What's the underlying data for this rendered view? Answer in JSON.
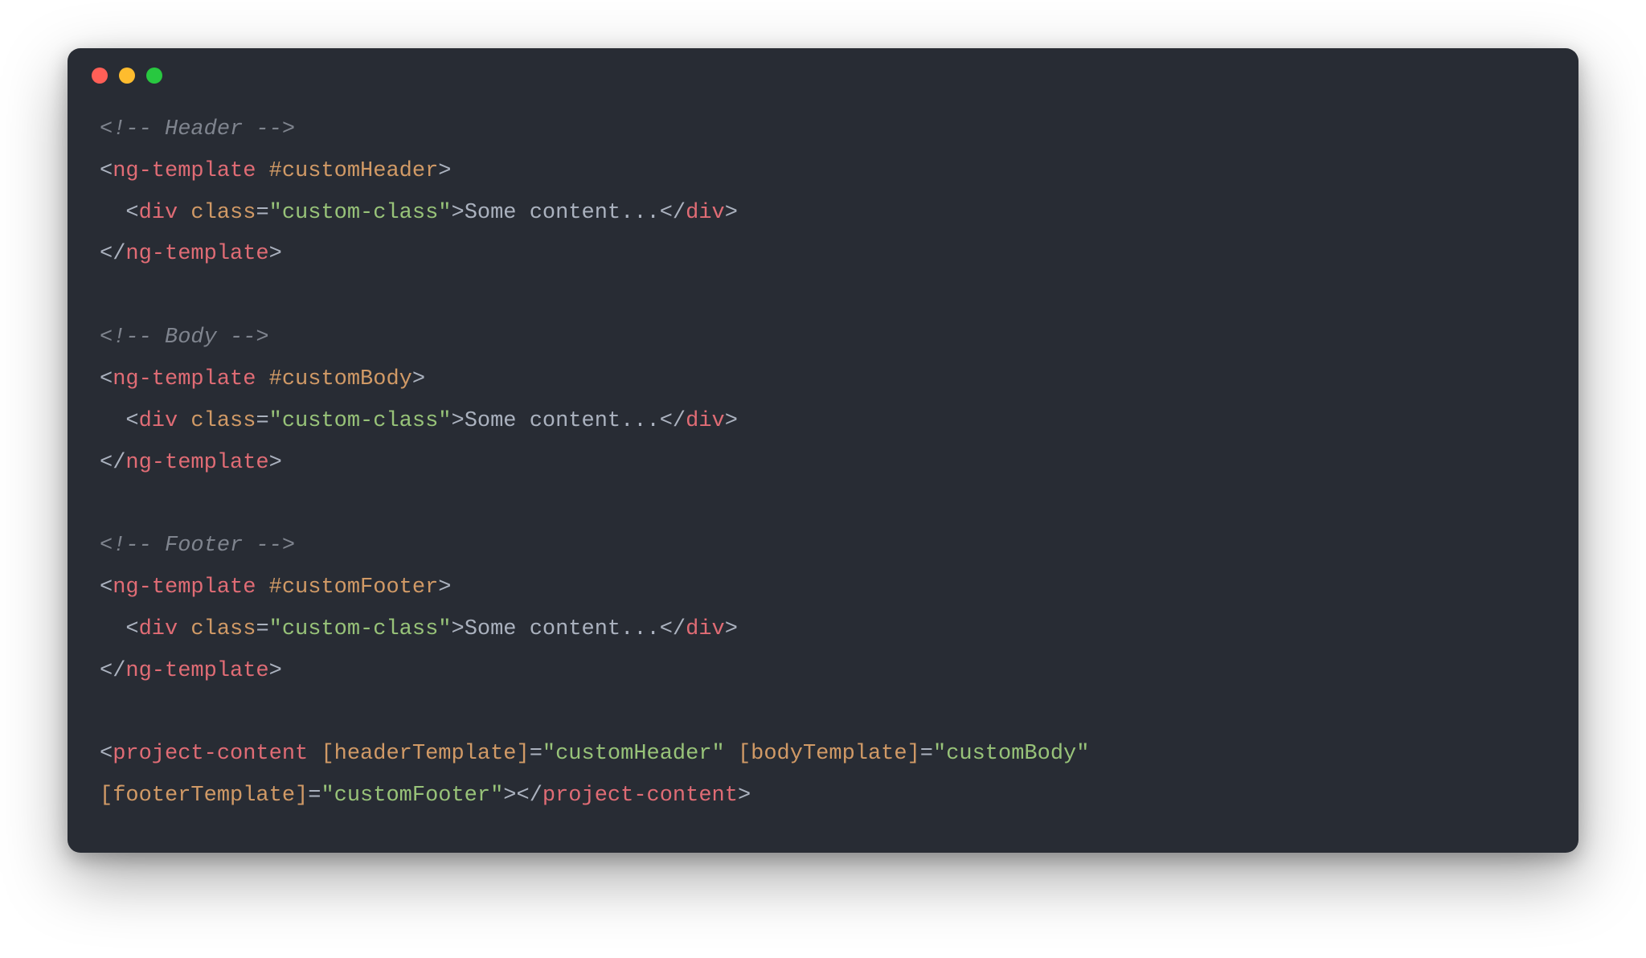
{
  "window": {
    "traffic_lights": [
      "red",
      "yellow",
      "green"
    ]
  },
  "tokens": {
    "comment_header": "<!-- Header -->",
    "comment_body": "<!-- Body -->",
    "comment_footer": "<!-- Footer -->",
    "lt": "<",
    "lt_slash": "</",
    "gt": ">",
    "gt_close": ">",
    "eq": "=",
    "tag_ngtemplate": "ng-template",
    "tag_div": "div",
    "tag_project_content": "project-content",
    "ref_customHeader": "#customHeader",
    "ref_customBody": "#customBody",
    "ref_customFooter": "#customFooter",
    "attr_class": "class",
    "attr_headerTemplate": "[headerTemplate]",
    "attr_bodyTemplate": "[bodyTemplate]",
    "attr_footerTemplate": "[footerTemplate]",
    "val_custom_class": "\"custom-class\"",
    "val_customHeader": "\"customHeader\"",
    "val_customBody": "\"customBody\"",
    "val_customFooter": "\"customFooter\"",
    "text_some_content": "Some content..."
  }
}
